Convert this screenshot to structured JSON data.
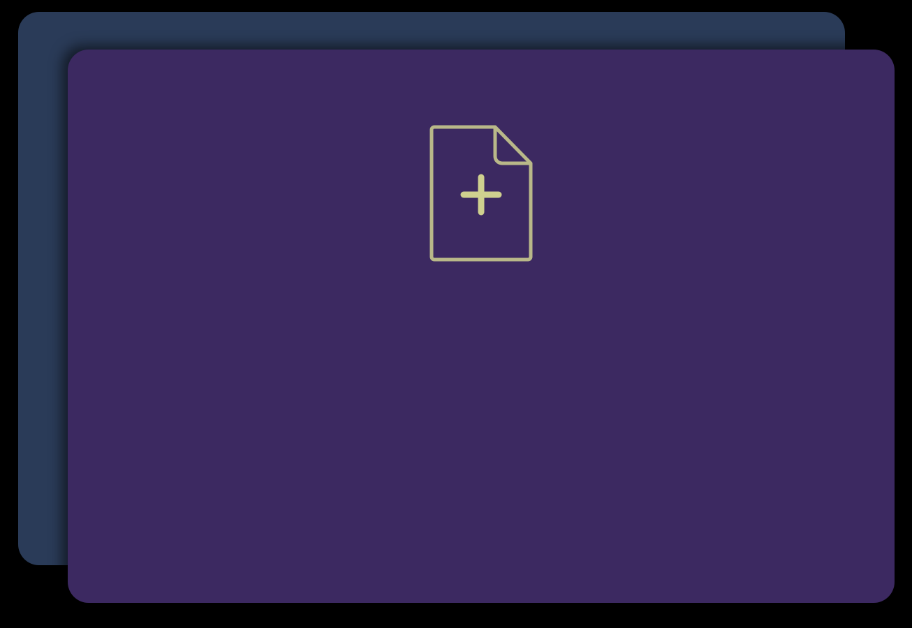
{
  "colors": {
    "page_background": "#000000",
    "back_card": "#2a3b58",
    "front_card": "#3c2961",
    "icon_stroke": "#b9b889",
    "icon_plus": "#cfd08f"
  },
  "icons": {
    "new_file": "file-plus-icon"
  }
}
